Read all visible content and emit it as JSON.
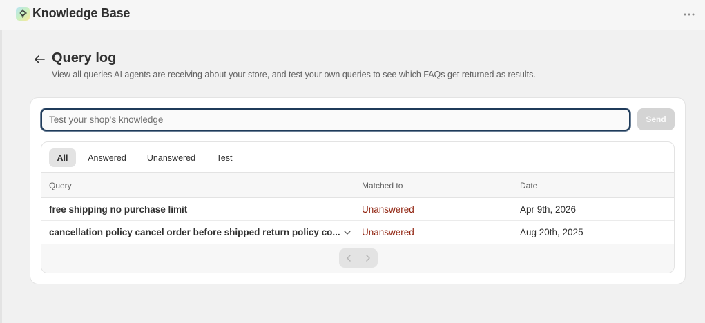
{
  "header": {
    "app_title": "Knowledge Base",
    "app_icon": "lightbulb-icon",
    "more_icon": "more-horizontal-icon"
  },
  "page": {
    "title": "Query log",
    "subtitle": "View all queries AI agents are receiving about your store, and test your own queries to see which FAQs get returned as results.",
    "back_icon": "arrow-left-icon"
  },
  "search": {
    "placeholder": "Test your shop's knowledge",
    "value": "",
    "send_label": "Send"
  },
  "tabs": [
    {
      "label": "All",
      "active": true
    },
    {
      "label": "Answered",
      "active": false
    },
    {
      "label": "Unanswered",
      "active": false
    },
    {
      "label": "Test",
      "active": false
    }
  ],
  "table": {
    "columns": [
      "Query",
      "Matched to",
      "Date"
    ],
    "rows": [
      {
        "query": "free shipping no purchase limit",
        "matched_to": "Unanswered",
        "date": "Apr 9th, 2026",
        "expandable": false
      },
      {
        "query": "cancellation policy cancel order before shipped return policy co...",
        "matched_to": "Unanswered",
        "date": "Aug 20th, 2025",
        "expandable": true
      }
    ]
  },
  "pagination": {
    "prev_icon": "chevron-left-icon",
    "next_icon": "chevron-right-icon"
  },
  "colors": {
    "unanswered": "#8e1f0b",
    "input_focus": "#1f3b5a",
    "background": "#f1f1f1"
  }
}
